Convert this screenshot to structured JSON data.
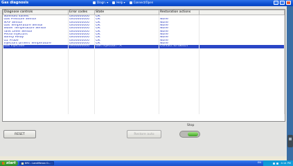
{
  "window": {
    "title": "Gas diagnosis"
  },
  "menu": {
    "items": [
      {
        "icon": "tool-icon",
        "label": "Diagn. ▾"
      },
      {
        "icon": "help-icon",
        "label": "Help ▾"
      },
      {
        "icon": "window-icon",
        "label": "Connect/Open"
      }
    ]
  },
  "table": {
    "columns": [
      "Diagnose controls",
      "Error codes",
      "State",
      "Restoration actions"
    ],
    "rows": [
      {
        "control": "Solenoid valves",
        "code": "0x00000000",
        "state": "OK",
        "action": ""
      },
      {
        "control": "Gas Pressure Sensor",
        "code": "0x00000000",
        "state": "OK",
        "action": "None"
      },
      {
        "control": "MAP Sensor",
        "code": "0x00000000",
        "state": "OK",
        "action": "None"
      },
      {
        "control": "Gas Temperature Sensor",
        "code": "0x00000000",
        "state": "OK",
        "action": "None"
      },
      {
        "control": "Water Temperature Sensor",
        "code": "0x00000000",
        "state": "OK",
        "action": "None"
      },
      {
        "control": "Tank Level Sensor",
        "code": "0x00000000",
        "state": "OK",
        "action": "None"
      },
      {
        "control": "Petrol Injectors",
        "code": "0x00000000",
        "state": "OK",
        "action": "None"
      },
      {
        "control": "Safety Relay",
        "code": "0x00000000",
        "state": "OK",
        "action": "None"
      },
      {
        "control": "O2 Probe",
        "code": "0x00000000",
        "state": "OK",
        "action": "None"
      },
      {
        "control": "Injectors Drivers Temperature",
        "code": "0x00000000",
        "state": "OK",
        "action": "None"
      },
      {
        "control": "Gas Injection",
        "code": "0x00000000",
        "state": "Gas Injection - A",
        "action": "Contact to switch",
        "selected": true
      }
    ]
  },
  "buttons": {
    "reset": "RESET",
    "apply": "Restore auto"
  },
  "stop": {
    "label": "Stop",
    "active": true
  },
  "taskbar": {
    "start": "start",
    "task": "BRC - LandiRenzo O...",
    "lang": "EN",
    "clock": "4:14 PM"
  }
}
